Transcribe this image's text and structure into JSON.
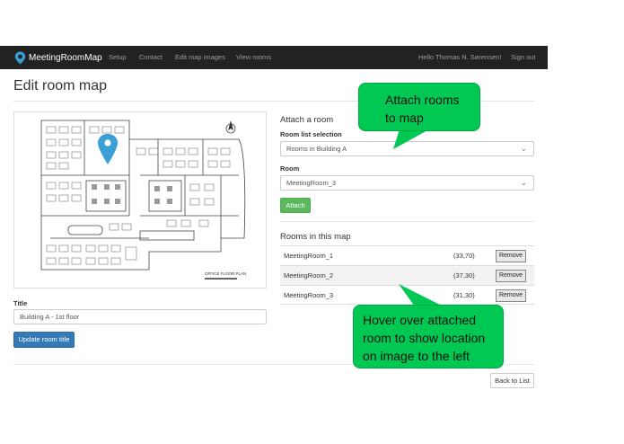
{
  "navbar": {
    "brand": "MeetingRoomMap",
    "links": [
      "Setup",
      "Contact",
      "Edit map images",
      "View rooms"
    ],
    "greeting": "Hello Thomas N. Sørensen!",
    "signout": "Sign out"
  },
  "page": {
    "title": "Edit room map"
  },
  "map": {
    "floorplan_caption": "OFFICE FLOOR PLAN"
  },
  "title_form": {
    "label": "Title",
    "value": "Building A - 1st floor",
    "update_button": "Update room title"
  },
  "attach": {
    "heading": "Attach a room",
    "room_list_label": "Room list selection",
    "room_list_value": "Rooms in Building A",
    "room_label": "Room",
    "room_value": "MeetingRoom_3",
    "attach_button": "Attach"
  },
  "rooms": {
    "heading": "Rooms in this map",
    "remove_label": "Remove",
    "items": [
      {
        "name": "MeetingRoom_1",
        "coords": "(33,70)"
      },
      {
        "name": "MeetingRoom_2",
        "coords": "(37,30)"
      },
      {
        "name": "MeetingRoom_3",
        "coords": "(31,30)"
      }
    ]
  },
  "back_button": "Back to List",
  "callouts": {
    "attach": [
      "Attach rooms",
      "to map"
    ],
    "hover": [
      "Hover over attached",
      "room to show location",
      "on image to the left"
    ]
  },
  "colors": {
    "navbar": "#222222",
    "primary": "#337ab7",
    "success": "#5cb85c",
    "callout": "#00c853",
    "marker": "#3a9fd6"
  },
  "icons": {
    "logo": "map-pin-icon",
    "marker": "location-pin-icon",
    "compass": "compass-arrow-icon",
    "select": "chevron-down-icon"
  }
}
